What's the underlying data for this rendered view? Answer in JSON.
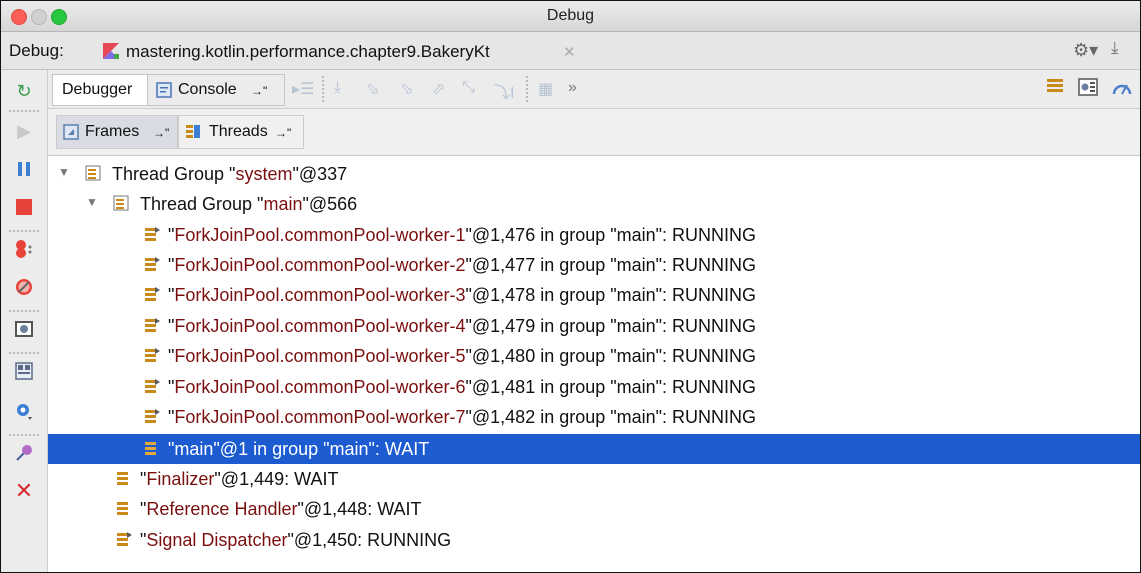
{
  "window": {
    "title": "Debug"
  },
  "tabbar": {
    "debug_label": "Debug:",
    "session_name": "mastering.kotlin.performance.chapter9.BakeryKt"
  },
  "toolbar": {
    "debugger_tab": "Debugger",
    "console_tab": "Console",
    "console_pin": "→\"",
    "more": "»"
  },
  "panels": {
    "frames": "Frames",
    "frames_pin": "→\"",
    "threads": "Threads",
    "threads_pin": "→\""
  },
  "tree": [
    {
      "pre": "Thread Group \"",
      "name": "system",
      "post": "\"@337"
    },
    {
      "pre": "Thread Group \"",
      "name": "main",
      "post": "\"@566"
    },
    {
      "pre": "\"",
      "name": "ForkJoinPool.commonPool-worker-1",
      "post": "\"@1,476 in group \"main\": RUNNING"
    },
    {
      "pre": "\"",
      "name": "ForkJoinPool.commonPool-worker-2",
      "post": "\"@1,477 in group \"main\": RUNNING"
    },
    {
      "pre": "\"",
      "name": "ForkJoinPool.commonPool-worker-3",
      "post": "\"@1,478 in group \"main\": RUNNING"
    },
    {
      "pre": "\"",
      "name": "ForkJoinPool.commonPool-worker-4",
      "post": "\"@1,479 in group \"main\": RUNNING"
    },
    {
      "pre": "\"",
      "name": "ForkJoinPool.commonPool-worker-5",
      "post": "\"@1,480 in group \"main\": RUNNING"
    },
    {
      "pre": "\"",
      "name": "ForkJoinPool.commonPool-worker-6",
      "post": "\"@1,481 in group \"main\": RUNNING"
    },
    {
      "pre": "\"",
      "name": "ForkJoinPool.commonPool-worker-7",
      "post": "\"@1,482 in group \"main\": RUNNING"
    },
    {
      "pre": "\"",
      "name": "main",
      "post": "\"@1 in group \"main\": WAIT"
    },
    {
      "pre": "\"",
      "name": "Finalizer",
      "post": "\"@1,449: WAIT"
    },
    {
      "pre": "\"",
      "name": "Reference Handler",
      "post": "\"@1,448: WAIT"
    },
    {
      "pre": "\"",
      "name": "Signal Dispatcher",
      "post": "\"@1,450: RUNNING"
    }
  ],
  "colors": {
    "selection": "#1c5bd0",
    "string": "#7a0f0f",
    "stop": "#e8433a",
    "pause": "#3f7fd0"
  },
  "icons": [
    "rerun-icon",
    "resume-icon",
    "pause-icon",
    "stop-icon",
    "view-breakpoints-icon",
    "mute-breakpoints-icon",
    "get-thread-dump-icon",
    "restore-layout-icon",
    "settings-icon",
    "pin-icon",
    "close-icon"
  ]
}
